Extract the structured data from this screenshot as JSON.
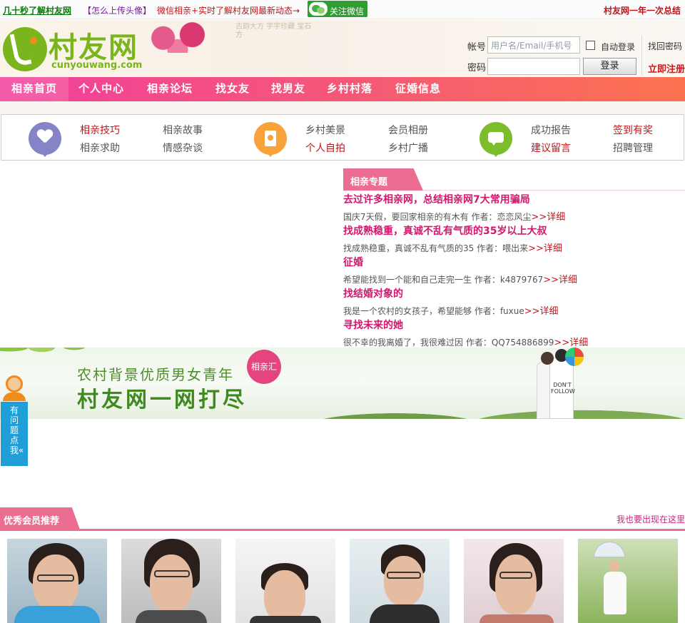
{
  "topbar": {
    "learn_link": "几十秒了解村友网",
    "upload_link": "【怎么上传头像】",
    "wechat_text": "微信相亲+实时了解村友网最新动态→",
    "wechat_button": "关注微信",
    "summary_link": "村友网一年一次总结"
  },
  "header": {
    "logo_text": "村友网",
    "logo_url": "cunyouwang.com",
    "calligraphy": "古韵大方 字字珍藏 宝石方",
    "login": {
      "account_label": "帐号",
      "account_placeholder": "用户名/Email/手机号",
      "password_label": "密码",
      "auto_login": "自动登录",
      "find_password": "找回密码",
      "login_button": "登录",
      "register": "立即注册"
    }
  },
  "nav": {
    "items": [
      "相亲首页",
      "个人中心",
      "相亲论坛",
      "找女友",
      "找男友",
      "乡村村落",
      "征婚信息"
    ]
  },
  "quick_links": {
    "group1": [
      "相亲技巧",
      "相亲故事",
      "相亲求助",
      "情感杂谈"
    ],
    "group2": [
      "乡村美景",
      "会员相册",
      "个人自拍",
      "乡村广播"
    ],
    "group3": [
      "成功报告",
      "签到有奖",
      "建议留言",
      "招聘管理"
    ]
  },
  "feature": {
    "heading": "相亲专题",
    "more_label": ">>详细",
    "articles": [
      {
        "title": "去过许多相亲网，总结相亲网7大常用骗局",
        "desc": "国庆7天假，要回家相亲的有木有 作者：恋恋风尘"
      },
      {
        "title": "找成熟稳重，真诚不乱有气质的35岁以上大叔",
        "desc": "找成熟稳重，真诚不乱有气质的35 作者：喂出来"
      },
      {
        "title": "征婚",
        "desc": "希望能找到一个能和自己走完一生 作者：k4879767"
      },
      {
        "title": "找结婚对象的",
        "desc": "我是一个农村的女孩子，希望能够 作者：fuxue"
      },
      {
        "title": "寻找未来的她",
        "desc": "很不幸的我离婚了，我很难过因 作者：QQ754886899"
      }
    ]
  },
  "banner": {
    "subtitle": "农村背景优质男女青年",
    "main": "村友网一网打尽",
    "badge": "相亲汇",
    "shirt_text": "DON'T FOLLOW"
  },
  "help_tab": {
    "text": "有问题点我«"
  },
  "members": {
    "heading": "优秀会员推荐",
    "more": "我也要出现在这里",
    "photos": [
      "member-photo-1",
      "member-photo-2",
      "member-photo-3",
      "member-photo-4",
      "member-photo-5",
      "member-photo-6"
    ]
  },
  "colors": {
    "nav_gradient_start": "#f23f9c",
    "nav_gradient_end": "#fd7350",
    "accent_pink": "#ec6d92",
    "title_pink": "#d1186d",
    "link_red": "#c4161c",
    "logo_green": "#7ab51d"
  }
}
